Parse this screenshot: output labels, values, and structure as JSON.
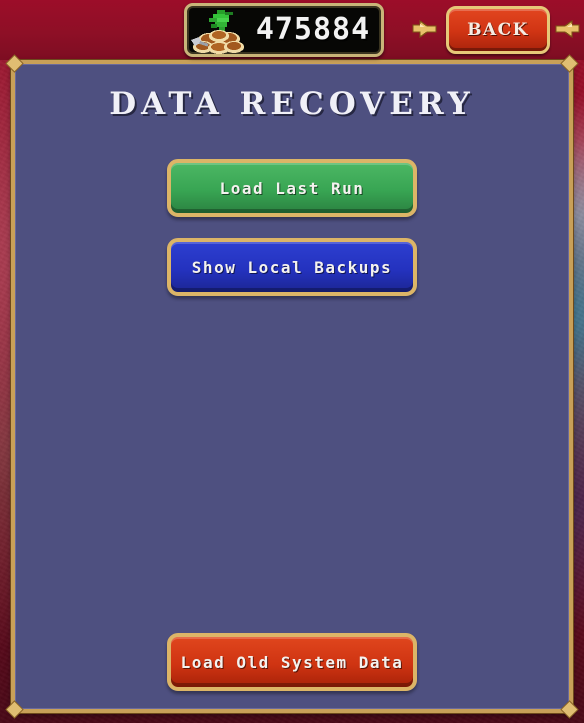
{
  "hud": {
    "money": {
      "icon": "coin-pile-icon",
      "value": "475884"
    },
    "bumper_left": {
      "icon": "bumper-arrow-left-icon"
    },
    "bumper_right": {
      "icon": "bumper-arrow-right-icon"
    },
    "back_button": {
      "label": "BACK"
    }
  },
  "panel": {
    "title": "DATA RECOVERY",
    "buttons": [
      {
        "label": "Load Last Run",
        "color": "#38a553"
      },
      {
        "label": "Show Local Backups",
        "color": "#2432bf"
      },
      {
        "label": "Load Old System Data",
        "color": "#cf3412"
      }
    ]
  },
  "colors": {
    "panel_background": "#4e5080",
    "panel_border_gold": "#c8a058",
    "backdrop_red": "#8c1028",
    "text_light": "#f0f0f7"
  }
}
